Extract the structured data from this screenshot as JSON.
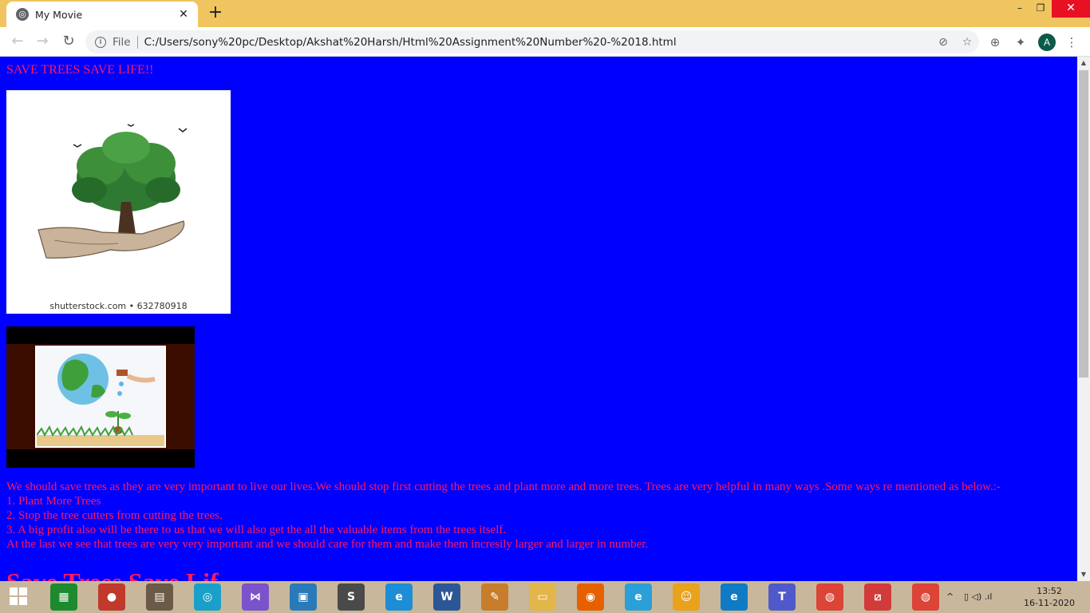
{
  "browser": {
    "tab_title": "My Movie",
    "tab_close": "✕",
    "new_tab": "+",
    "window_minimize": "–",
    "window_maximize": "❐",
    "window_close": "✕",
    "nav_back": "←",
    "nav_forward": "→",
    "nav_reload": "↻",
    "info_glyph": "i",
    "file_label": "File",
    "url": "C:/Users/sony%20pc/Desktop/Akshat%20Harsh/Html%20Assignment%20Number%20-%2018.html",
    "omnibox_icons": [
      "eye-off-icon",
      "star-icon"
    ],
    "eye_off_glyph": "⊘",
    "star_glyph": "☆",
    "lens_glyph": "⊕",
    "extensions_glyph": "✦",
    "menu_glyph": "⋮",
    "profile_initial": "A"
  },
  "page": {
    "heading": "SAVE TREES SAVE LIFE!!",
    "image1_caption": "shutterstock.com • 632780918",
    "paragraph_lines": [
      "We should save trees as they are very important to live our lives.We should stop first cutting the trees and plant more and more trees. Trees are very helpful in many ways .Some ways re mentioned as below.:-",
      "1. Plant More Trees",
      "2. Stop the tree cutters from cutting the trees.",
      "3. A big profit also will be there to us that we will also get the all the valuable items from the trees itself.",
      "At the last we see that trees are very very important and we should care for them and make them incresily larger and larger in number."
    ],
    "big_heading": "Save Trees Save Lif",
    "colors": {
      "background": "#0000ff",
      "text": "#ff1a5e"
    }
  },
  "scrollbar": {
    "up": "▲",
    "down": "▼"
  },
  "taskbar": {
    "apps": [
      {
        "name": "store-app",
        "glyph": "▦",
        "color": "#1e8a2e"
      },
      {
        "name": "recorder-app",
        "glyph": "●",
        "color": "#c0392b"
      },
      {
        "name": "scanner-app",
        "glyph": "▤",
        "color": "#6b5a48"
      },
      {
        "name": "media-app",
        "glyph": "◎",
        "color": "#1aa0c8"
      },
      {
        "name": "visual-studio-app",
        "glyph": "⋈",
        "color": "#7b52c9"
      },
      {
        "name": "movie-maker-app",
        "glyph": "▣",
        "color": "#2a7ab8"
      },
      {
        "name": "sublime-app",
        "glyph": "S",
        "color": "#4a4a4a"
      },
      {
        "name": "edge-app",
        "glyph": "e",
        "color": "#1c8dd6"
      },
      {
        "name": "word-app",
        "glyph": "W",
        "color": "#2b5797"
      },
      {
        "name": "paint-app",
        "glyph": "✎",
        "color": "#c77d2b"
      },
      {
        "name": "file-explorer-app",
        "glyph": "▭",
        "color": "#e2b64a"
      },
      {
        "name": "firefox-app",
        "glyph": "◉",
        "color": "#e66000"
      },
      {
        "name": "internet-explorer-app",
        "glyph": "e",
        "color": "#2a9fd8"
      },
      {
        "name": "scratch-app",
        "glyph": "☺",
        "color": "#e8a21c"
      },
      {
        "name": "edge-beta-app",
        "glyph": "e",
        "color": "#0f7bc4"
      },
      {
        "name": "teams-app",
        "glyph": "T",
        "color": "#5059c9"
      },
      {
        "name": "chrome-app",
        "glyph": "◍",
        "color": "#db4437"
      },
      {
        "name": "acrobat-app",
        "glyph": "⧄",
        "color": "#d23b3b"
      },
      {
        "name": "chrome-active-app",
        "glyph": "◍",
        "color": "#db4437"
      }
    ],
    "tray_chevron": "^",
    "tray_icons": "▯ ◁) .ıl",
    "time": "13:52",
    "date": "16-11-2020"
  }
}
